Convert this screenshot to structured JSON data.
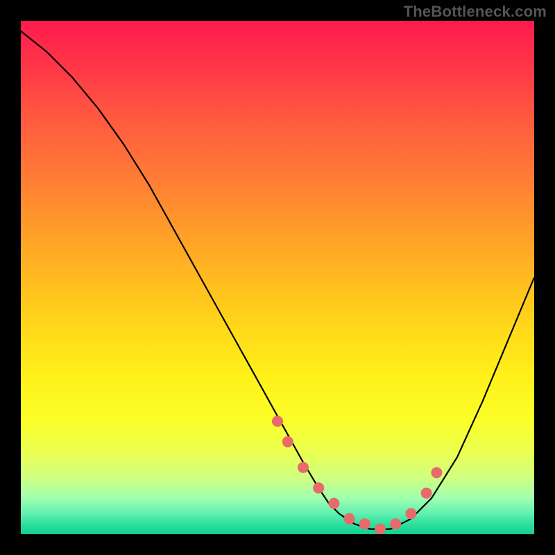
{
  "watermark": "TheBottleneck.com",
  "chart_data": {
    "type": "line",
    "title": "",
    "xlabel": "",
    "ylabel": "",
    "xlim": [
      0,
      100
    ],
    "ylim": [
      0,
      100
    ],
    "grid": false,
    "legend": false,
    "series": [
      {
        "name": "curve",
        "x": [
          0,
          5,
          10,
          15,
          20,
          25,
          30,
          35,
          40,
          45,
          50,
          55,
          58,
          60,
          62,
          65,
          68,
          72,
          76,
          80,
          85,
          90,
          95,
          100
        ],
        "values": [
          98,
          94,
          89,
          83,
          76,
          68,
          59,
          50,
          41,
          32,
          23,
          14,
          9,
          6,
          4,
          2,
          1,
          1,
          3,
          7,
          15,
          26,
          38,
          50
        ]
      }
    ],
    "markers": {
      "name": "highlight-points",
      "color": "#e86a6a",
      "radius": 8,
      "x": [
        50,
        52,
        55,
        58,
        61,
        64,
        67,
        70,
        73,
        76,
        79,
        81
      ],
      "values": [
        22,
        18,
        13,
        9,
        6,
        3,
        2,
        1,
        2,
        4,
        8,
        12
      ]
    },
    "background": {
      "type": "vertical-gradient",
      "stops": [
        {
          "pos": 0.0,
          "color": "#ff1a4d"
        },
        {
          "pos": 0.5,
          "color": "#ffd91a"
        },
        {
          "pos": 0.85,
          "color": "#eaff50"
        },
        {
          "pos": 1.0,
          "color": "#10d090"
        }
      ]
    }
  }
}
